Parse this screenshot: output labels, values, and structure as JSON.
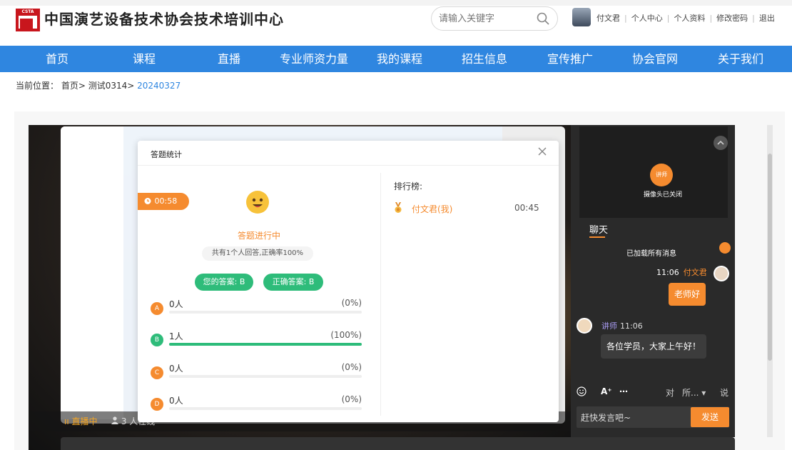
{
  "header": {
    "site_title": "中国演艺设备技术协会技术培训中心",
    "logo_text": "CSTA",
    "search_placeholder": "请输入关键字",
    "user_name": "付文君",
    "links": [
      "个人中心",
      "个人资料",
      "修改密码",
      "退出"
    ]
  },
  "nav": {
    "items": [
      "首页",
      "课程",
      "直播",
      "专业师资力量",
      "我的课程",
      "招生信息",
      "宣传推广",
      "协会官网",
      "关于我们"
    ]
  },
  "breadcrumb": {
    "prefix": "当前位置：",
    "path": "首页> 测试0314> ",
    "current": "20240327"
  },
  "player": {
    "live_status": "ıı 直播中",
    "viewers": "3 人在线"
  },
  "quiz_modal": {
    "title": "答题统计",
    "timer": "00:58",
    "status": "答题进行中",
    "summary": "共有1个人回答,正确率100%",
    "your_answer": "您的答案: B",
    "correct_answer": "正确答案: B",
    "options": [
      {
        "letter": "A",
        "count": "0人",
        "percent": "(0%)",
        "ratio": 0,
        "color": "#f58b2f"
      },
      {
        "letter": "B",
        "count": "1人",
        "percent": "(100%)",
        "ratio": 1,
        "color": "#2ebc7a"
      },
      {
        "letter": "C",
        "count": "0人",
        "percent": "(0%)",
        "ratio": 0,
        "color": "#f58b2f"
      },
      {
        "letter": "D",
        "count": "0人",
        "percent": "(0%)",
        "ratio": 0,
        "color": "#f58b2f"
      }
    ],
    "leaderboard_title": "排行榜:",
    "leaderboard": [
      {
        "name": "付文君(我)",
        "time": "00:45"
      }
    ]
  },
  "chat": {
    "cam_badge": "讲师",
    "cam_status": "摄像头已关闭",
    "tab": "聊天",
    "loaded_notice": "已加载所有消息",
    "messages": [
      {
        "time": "11:06",
        "sender": "付文君",
        "text": "老师好"
      },
      {
        "time": "11:06",
        "sender": "讲师",
        "text": "各位学员，大家上午好！"
      }
    ],
    "to_label": "对",
    "target": "所...",
    "say_label": "说",
    "input_placeholder": "赶快发言吧~",
    "send": "发送"
  }
}
